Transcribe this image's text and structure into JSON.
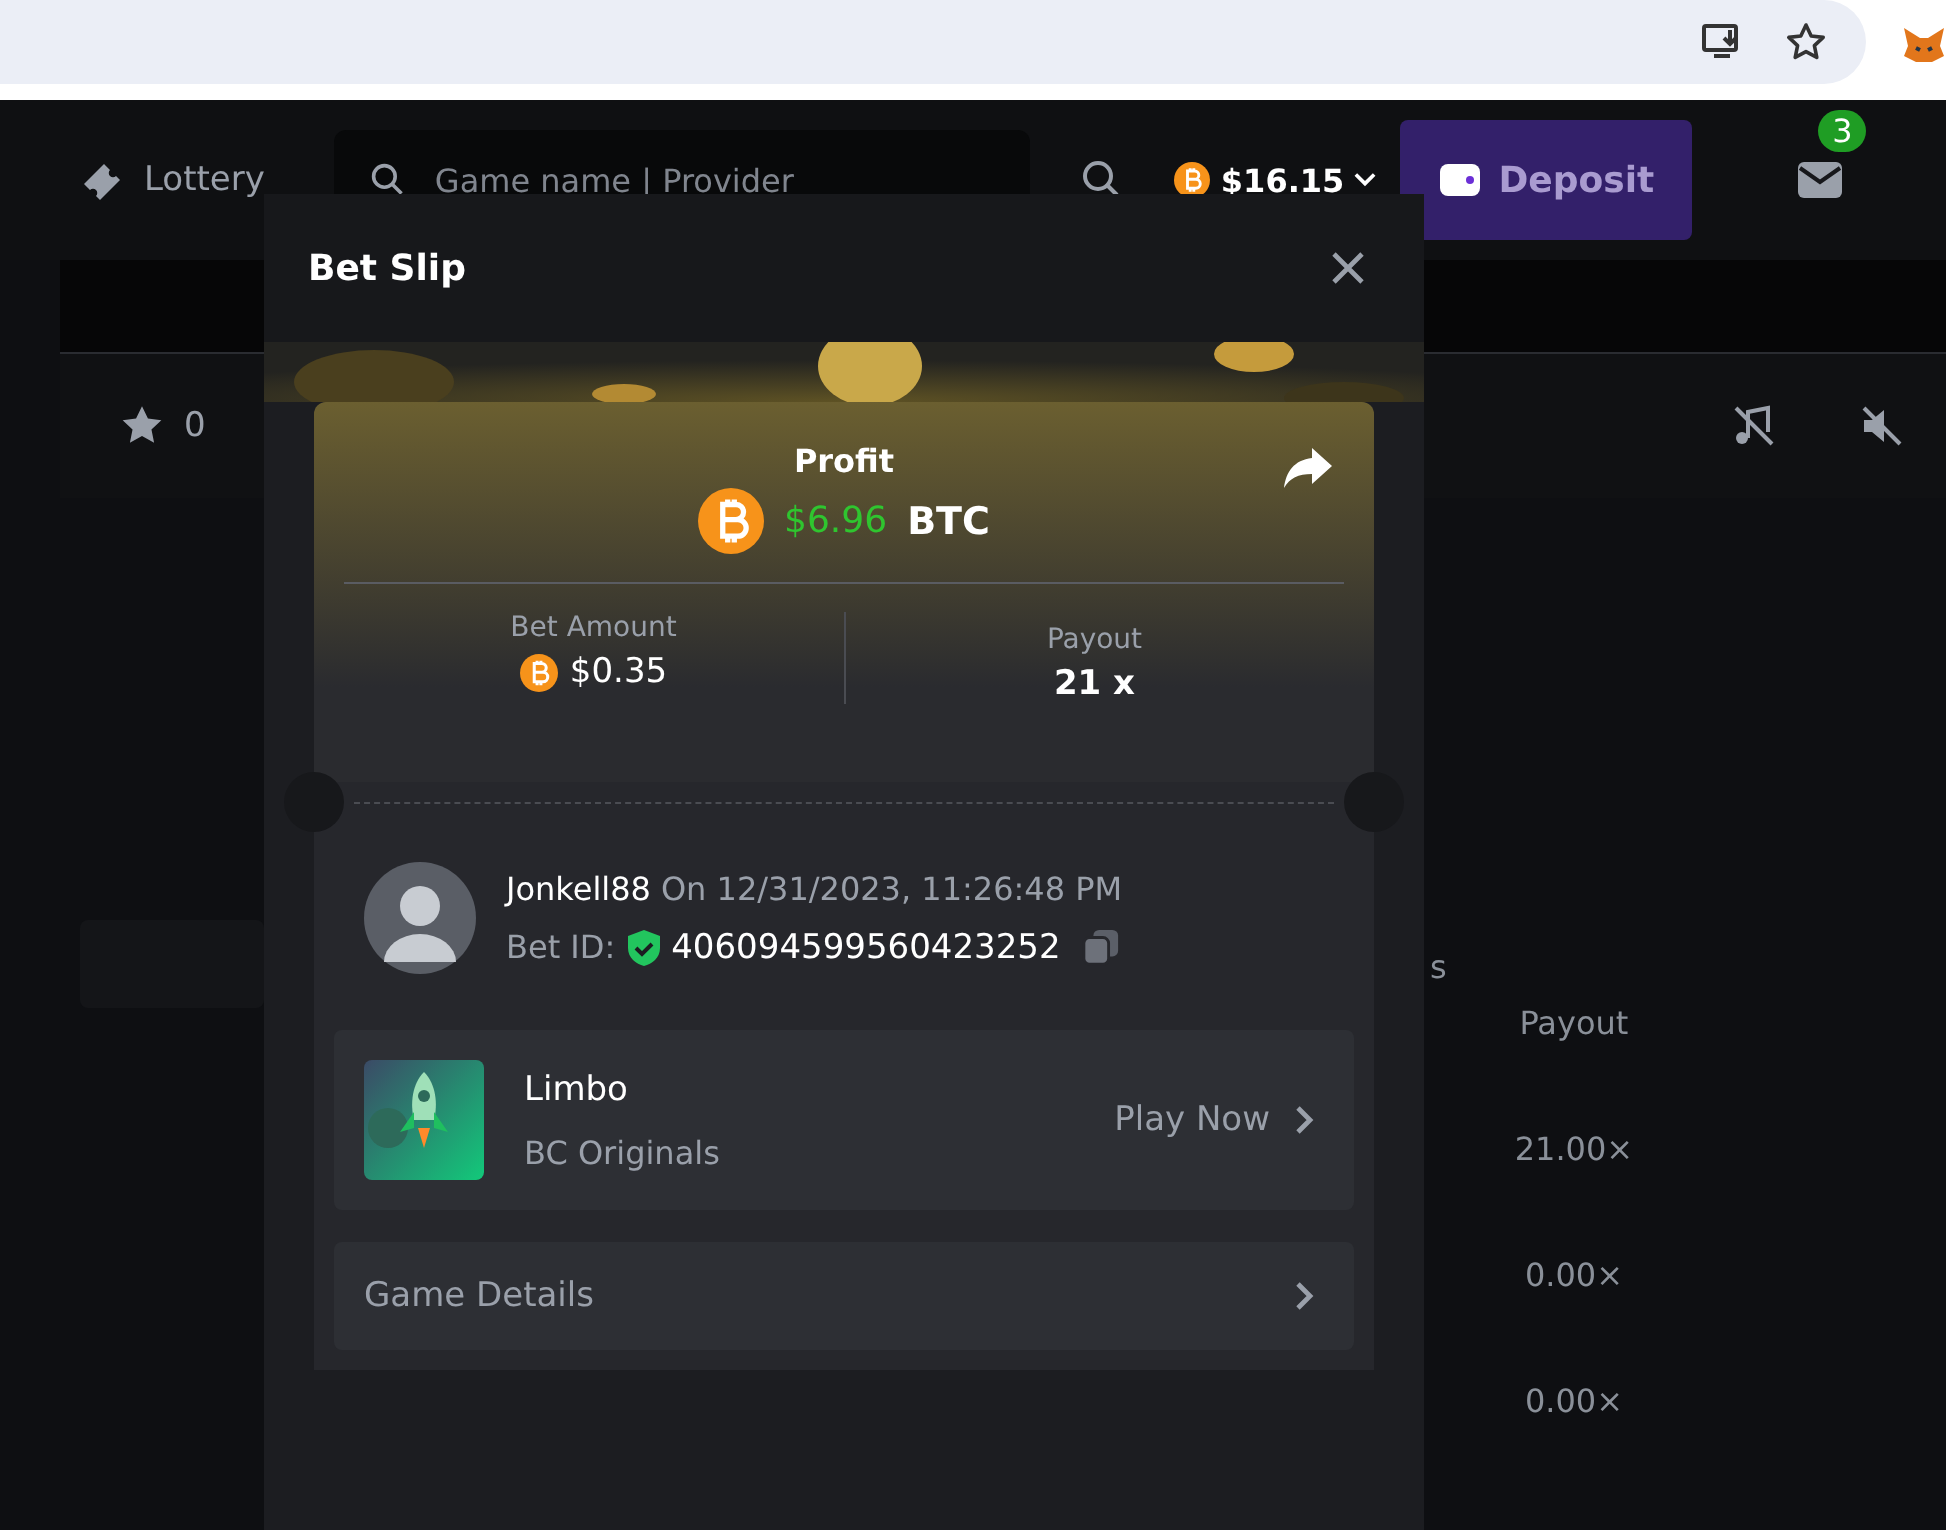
{
  "site_header": {
    "nav_item": "Lottery",
    "search": {
      "placeholder": "Game name | Provider"
    },
    "balance": "$16.15",
    "deposit_button": "Deposit",
    "mail_badge": "3"
  },
  "game_bar": {
    "favorites": "0"
  },
  "history_table": {
    "partial_text": "s",
    "columns": [
      "Payout"
    ],
    "rows": [
      [
        "21.00×"
      ],
      [
        "0.00×"
      ],
      [
        "0.00×"
      ]
    ]
  },
  "modal": {
    "title": "Bet Slip",
    "profit": {
      "label": "Profit",
      "amount": "$6.96",
      "currency": "BTC"
    },
    "bet_amount": {
      "label": "Bet Amount",
      "value": "$0.35"
    },
    "payout": {
      "label": "Payout",
      "value": "21 x"
    },
    "player": {
      "name": "Jonkell88",
      "date": "On 12/31/2023, 11:26:48 PM",
      "bet_id_label": "Bet ID:",
      "bet_id": "406094599560423252"
    },
    "game": {
      "name": "Limbo",
      "provider": "BC Originals",
      "action": "Play Now"
    },
    "details_link": "Game Details"
  }
}
